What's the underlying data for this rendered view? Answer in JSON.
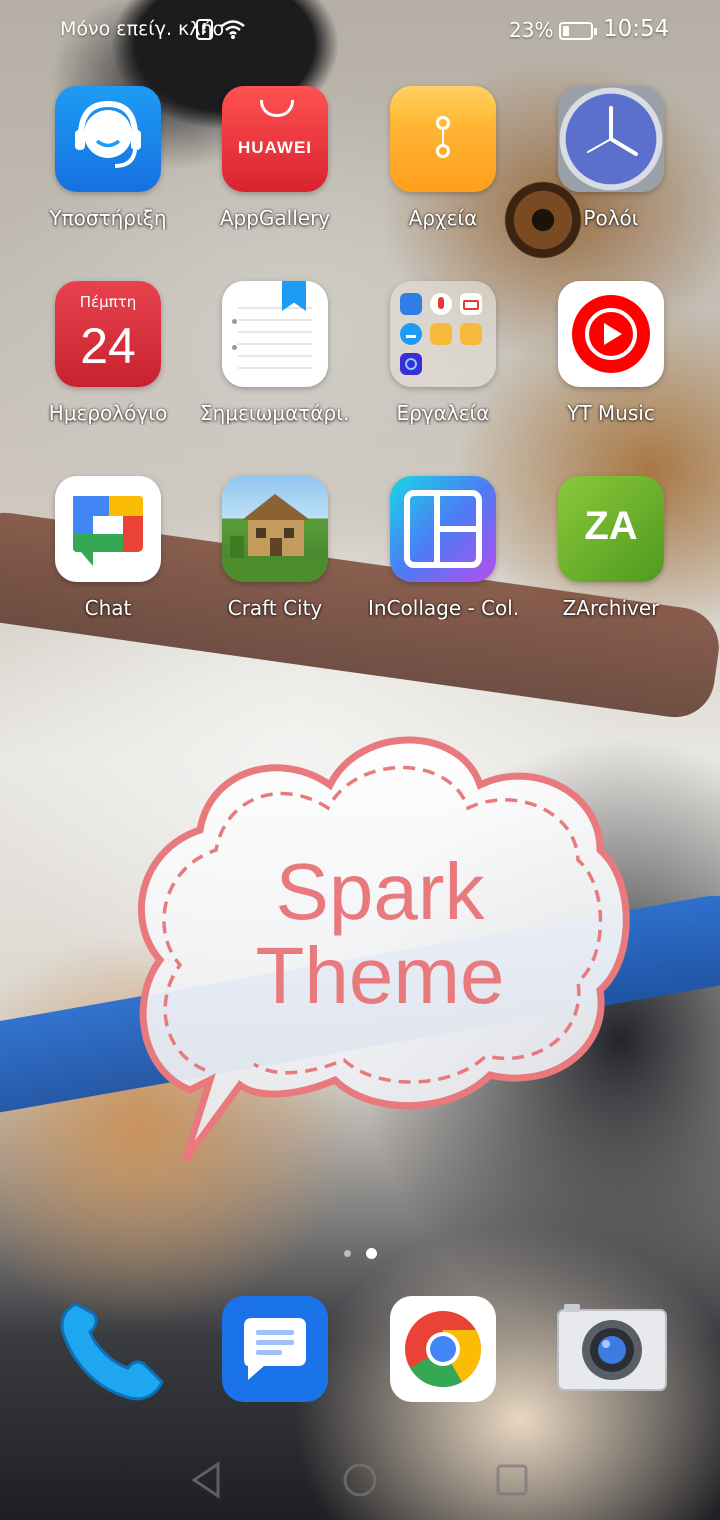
{
  "status_bar": {
    "carrier": "Μόνο επείγ. κλήσ",
    "alert_glyph": "!",
    "battery_percent": "23%",
    "battery_level": 0.23,
    "time": "10:54"
  },
  "apps": [
    {
      "label": "Υποστήριξη",
      "icon": "headset-support-icon"
    },
    {
      "label": "AppGallery",
      "icon": "huawei-appgallery-icon",
      "brand": "HUAWEI"
    },
    {
      "label": "Αρχεία",
      "icon": "files-folder-icon"
    },
    {
      "label": "Ρολόι",
      "icon": "clock-icon"
    },
    {
      "label": "Ημερολόγιο",
      "icon": "calendar-icon",
      "weekday": "Πέμπτη",
      "day": "24"
    },
    {
      "label": "Σημειωματάρι..",
      "icon": "notepad-icon"
    },
    {
      "label": "Εργαλεία",
      "icon": "tools-folder-icon"
    },
    {
      "label": "YT Music",
      "icon": "yt-music-icon"
    },
    {
      "label": "Chat",
      "icon": "google-chat-icon"
    },
    {
      "label": "Craft City",
      "icon": "craft-city-icon"
    },
    {
      "label": "InCollage - Col..",
      "icon": "incollage-icon"
    },
    {
      "label": "ZArchiver",
      "icon": "zarchiver-icon",
      "glyph": "ZA"
    }
  ],
  "widget": {
    "line1": "Spark",
    "line2": "Theme",
    "color": "#e87a7e"
  },
  "pager": {
    "pages": 2,
    "current": 2
  },
  "dock": [
    {
      "icon": "phone-icon"
    },
    {
      "icon": "messages-icon"
    },
    {
      "icon": "chrome-icon"
    },
    {
      "icon": "camera-icon"
    }
  ],
  "navigation": [
    {
      "icon": "back-triangle-icon"
    },
    {
      "icon": "home-circle-icon"
    },
    {
      "icon": "recents-square-icon"
    }
  ]
}
